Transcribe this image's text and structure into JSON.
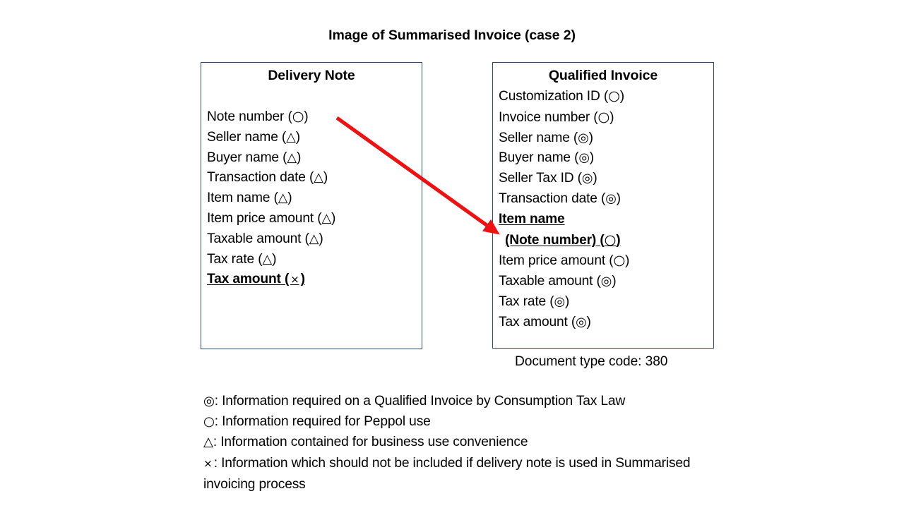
{
  "title": "Image of Summarised Invoice (case 2)",
  "symbols": {
    "double_circle": "◎",
    "circle": "○",
    "triangle": "△",
    "cross": "×"
  },
  "delivery_note": {
    "heading": "Delivery Note",
    "fields": [
      {
        "label": "Note number",
        "symbol": "○"
      },
      {
        "label": "Seller name",
        "symbol": "△"
      },
      {
        "label": "Buyer name",
        "symbol": "△"
      },
      {
        "label": "Transaction date",
        "symbol": "△"
      },
      {
        "label": "Item name",
        "symbol": "△"
      },
      {
        "label": "Item price amount",
        "symbol": "△"
      },
      {
        "label": "Taxable amount",
        "symbol": "△"
      },
      {
        "label": "Tax rate",
        "symbol": "△"
      },
      {
        "label": "Tax amount",
        "symbol": "×",
        "emphasis": true
      }
    ]
  },
  "qualified_invoice": {
    "heading": "Qualified Invoice",
    "fields": [
      {
        "label": "Customization ID",
        "symbol": "○"
      },
      {
        "label": "Invoice number",
        "symbol": "○"
      },
      {
        "label": "Seller name",
        "symbol": "◎"
      },
      {
        "label": "Buyer name",
        "symbol": "◎"
      },
      {
        "label": "Seller Tax ID",
        "symbol": "◎"
      },
      {
        "label": "Transaction date",
        "symbol": "◎"
      },
      {
        "label": "Item name",
        "symbol": "",
        "emphasis": true
      },
      {
        "label": "(Note number)",
        "symbol": "○",
        "emphasis": true,
        "indented": true
      },
      {
        "label": "Item price amount",
        "symbol": "○"
      },
      {
        "label": "Taxable amount",
        "symbol": "◎"
      },
      {
        "label": "Tax rate",
        "symbol": "◎"
      },
      {
        "label": "Tax amount",
        "symbol": "◎"
      }
    ],
    "document_type_code": "Document type code: 380"
  },
  "legend": [
    {
      "symbol": "◎",
      "text": ": Information required on a Qualified Invoice by Consumption Tax Law"
    },
    {
      "symbol": "○",
      "text": ": Information required for Peppol use"
    },
    {
      "symbol": "△",
      "text": ": Information contained for business use convenience"
    },
    {
      "symbol": "×",
      "text": ": Information which should not be included if delivery note is used in Summarised invoicing process"
    }
  ],
  "arrow": {
    "color": "#ee1111",
    "from_label": "Note number",
    "to_label": "(Note number)"
  }
}
